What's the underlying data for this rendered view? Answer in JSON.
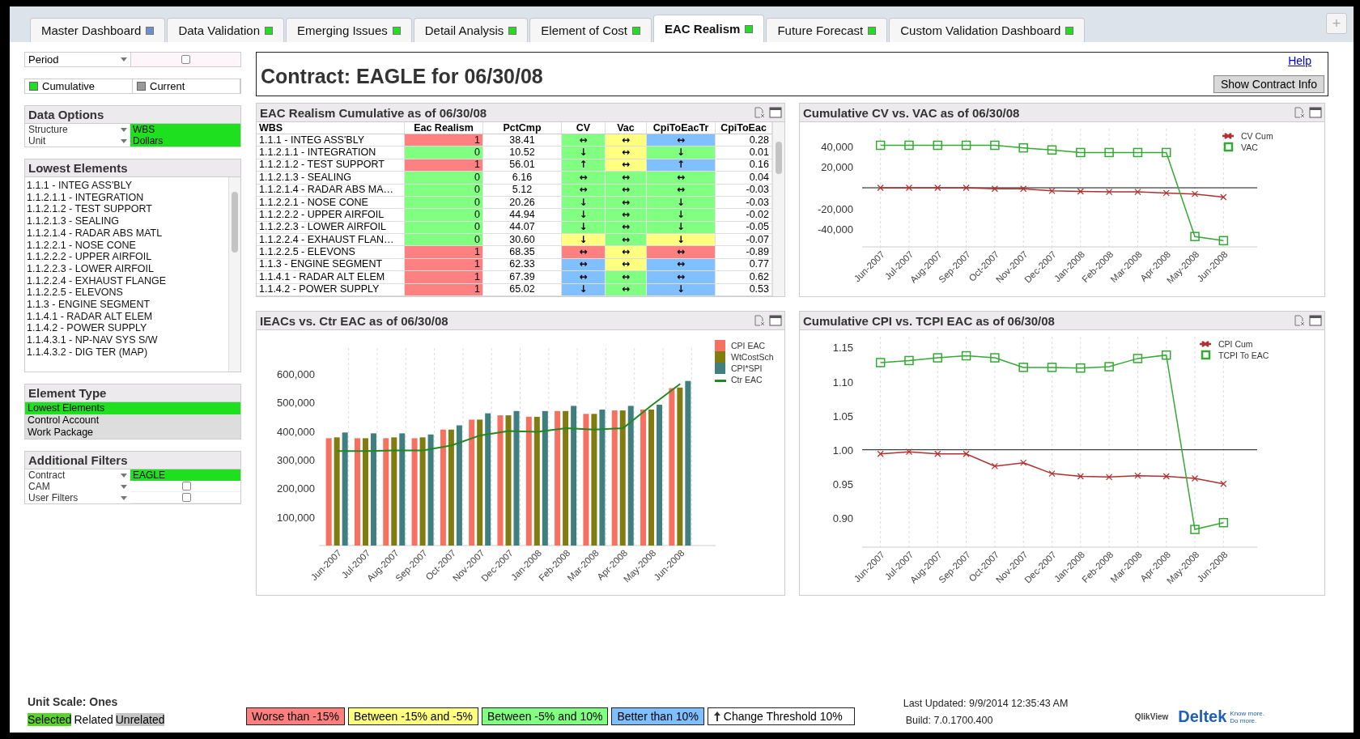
{
  "tabs": [
    {
      "label": "Master Dashboard",
      "color": "#6f8fcf",
      "selected": false
    },
    {
      "label": "Data Validation",
      "color": "#22dd22",
      "selected": false
    },
    {
      "label": "Emerging Issues",
      "color": "#22dd22",
      "selected": false
    },
    {
      "label": "Detail Analysis",
      "color": "#22dd22",
      "selected": false
    },
    {
      "label": "Element of Cost",
      "color": "#22dd22",
      "selected": false
    },
    {
      "label": "EAC Realism",
      "color": "#22dd22",
      "selected": true
    },
    {
      "label": "Future Forecast",
      "color": "#22dd22",
      "selected": false
    },
    {
      "label": "Custom Validation Dashboard",
      "color": "#22dd22",
      "selected": false
    }
  ],
  "add_tab": "+",
  "period": {
    "label": "Period",
    "checked": false
  },
  "view_mode": [
    {
      "label": "Cumulative",
      "selected": true
    },
    {
      "label": "Current",
      "selected": false
    }
  ],
  "data_options": {
    "title": "Data Options",
    "fields": [
      {
        "label": "Structure",
        "value": "WBS"
      },
      {
        "label": "Unit",
        "value": "Dollars"
      }
    ]
  },
  "lowest_elements": {
    "title": "Lowest Elements",
    "items": [
      "1.1.1 - INTEG ASS'BLY",
      "1.1.2.1.1 - INTEGRATION",
      "1.1.2.1.2 - TEST SUPPORT",
      "1.1.2.1.3 - SEALING",
      "1.1.2.1.4 - RADAR ABS MATL",
      "1.1.2.2.1 - NOSE CONE",
      "1.1.2.2.2 - UPPER AIRFOIL",
      "1.1.2.2.3 - LOWER AIRFOIL",
      "1.1.2.2.4 - EXHAUST FLANGE",
      "1.1.2.2.5 - ELEVONS",
      "1.1.3 - ENGINE SEGMENT",
      "1.1.4.1 - RADAR ALT ELEM",
      "1.1.4.2 - POWER SUPPLY",
      "1.1.4.3.1 - NP-NAV SYS S/W",
      "1.1.4.3.2 - DIG TER (MAP)"
    ]
  },
  "element_type": {
    "title": "Element Type",
    "items": [
      {
        "label": "Lowest Elements",
        "selected": true
      },
      {
        "label": "Control Account",
        "selected": false
      },
      {
        "label": "Work Package",
        "selected": false
      }
    ]
  },
  "additional_filters": {
    "title": "Additional Filters",
    "fields": [
      {
        "label": "Contract",
        "kind": "value",
        "value": "EAGLE"
      },
      {
        "label": "CAM",
        "kind": "checkbox",
        "checked": false
      },
      {
        "label": "User Filters",
        "kind": "checkbox",
        "checked": false
      }
    ]
  },
  "header": {
    "title": "Contract: EAGLE for 06/30/08",
    "help_link": "Help",
    "button": "Show Contract Info"
  },
  "table": {
    "title": "EAC Realism Cumulative as of 06/30/08",
    "columns": [
      "WBS",
      "Eac Realism",
      "PctCmp",
      "CV",
      "Vac",
      "CpiToEacTr",
      "CpiToEac"
    ],
    "rows": [
      {
        "wbs": "1.1.1 - INTEG ASS'BLY",
        "eac_realism": {
          "text": "1",
          "color": "#ff8080"
        },
        "pct_cmp": "38.41",
        "cv": {
          "text": "↔",
          "color": "#80ff80"
        },
        "vac": {
          "text": "↔",
          "color": "#ffff80"
        },
        "cpi_tr": {
          "text": "↔",
          "color": "#80c0ff"
        },
        "cpi_to_eac": "0.28"
      },
      {
        "wbs": "1.1.2.1.1 - INTEGRATION",
        "eac_realism": {
          "text": "0",
          "color": "#80ff80"
        },
        "pct_cmp": "10.52",
        "cv": {
          "text": "↓",
          "color": "#80ff80"
        },
        "vac": {
          "text": "↔",
          "color": "#ffff80"
        },
        "cpi_tr": {
          "text": "↓",
          "color": "#80ff80"
        },
        "cpi_to_eac": "0.01"
      },
      {
        "wbs": "1.1.2.1.2 - TEST SUPPORT",
        "eac_realism": {
          "text": "1",
          "color": "#ff8080"
        },
        "pct_cmp": "56.01",
        "cv": {
          "text": "↑",
          "color": "#80ff80"
        },
        "vac": {
          "text": "↔",
          "color": "#ffff80"
        },
        "cpi_tr": {
          "text": "↑",
          "color": "#80c0ff"
        },
        "cpi_to_eac": "0.16"
      },
      {
        "wbs": "1.1.2.1.3 - SEALING",
        "eac_realism": {
          "text": "0",
          "color": "#80ff80"
        },
        "pct_cmp": "6.16",
        "cv": {
          "text": "↔",
          "color": "#80ff80"
        },
        "vac": {
          "text": "↔",
          "color": "#80ff80"
        },
        "cpi_tr": {
          "text": "↔",
          "color": "#80ff80"
        },
        "cpi_to_eac": "0.04"
      },
      {
        "wbs": "1.1.2.1.4 - RADAR ABS MA…",
        "eac_realism": {
          "text": "0",
          "color": "#80ff80"
        },
        "pct_cmp": "5.12",
        "cv": {
          "text": "↔",
          "color": "#80ff80"
        },
        "vac": {
          "text": "↔",
          "color": "#80ff80"
        },
        "cpi_tr": {
          "text": "↔",
          "color": "#80ff80"
        },
        "cpi_to_eac": "-0.03"
      },
      {
        "wbs": "1.1.2.2.1 - NOSE CONE",
        "eac_realism": {
          "text": "0",
          "color": "#80ff80"
        },
        "pct_cmp": "20.26",
        "cv": {
          "text": "↓",
          "color": "#80ff80"
        },
        "vac": {
          "text": "↔",
          "color": "#80ff80"
        },
        "cpi_tr": {
          "text": "↓",
          "color": "#80ff80"
        },
        "cpi_to_eac": "-0.03"
      },
      {
        "wbs": "1.1.2.2.2 - UPPER AIRFOIL",
        "eac_realism": {
          "text": "0",
          "color": "#80ff80"
        },
        "pct_cmp": "44.94",
        "cv": {
          "text": "↓",
          "color": "#80ff80"
        },
        "vac": {
          "text": "↔",
          "color": "#80ff80"
        },
        "cpi_tr": {
          "text": "↓",
          "color": "#80ff80"
        },
        "cpi_to_eac": "-0.02"
      },
      {
        "wbs": "1.1.2.2.3 - LOWER AIRFOIL",
        "eac_realism": {
          "text": "0",
          "color": "#80ff80"
        },
        "pct_cmp": "44.07",
        "cv": {
          "text": "↓",
          "color": "#80ff80"
        },
        "vac": {
          "text": "↔",
          "color": "#80ff80"
        },
        "cpi_tr": {
          "text": "↓",
          "color": "#80ff80"
        },
        "cpi_to_eac": "-0.05"
      },
      {
        "wbs": "1.1.2.2.4 - EXHAUST FLAN…",
        "eac_realism": {
          "text": "0",
          "color": "#80ff80"
        },
        "pct_cmp": "30.60",
        "cv": {
          "text": "↓",
          "color": "#ffff80"
        },
        "vac": {
          "text": "↔",
          "color": "#80ff80"
        },
        "cpi_tr": {
          "text": "↓",
          "color": "#ffff80"
        },
        "cpi_to_eac": "-0.07"
      },
      {
        "wbs": "1.1.2.2.5 - ELEVONS",
        "eac_realism": {
          "text": "1",
          "color": "#ff8080"
        },
        "pct_cmp": "68.35",
        "cv": {
          "text": "↔",
          "color": "#ff8080"
        },
        "vac": {
          "text": "↔",
          "color": "#ffff80"
        },
        "cpi_tr": {
          "text": "↔",
          "color": "#ff8080"
        },
        "cpi_to_eac": "-0.89"
      },
      {
        "wbs": "1.1.3 - ENGINE SEGMENT",
        "eac_realism": {
          "text": "1",
          "color": "#ff8080"
        },
        "pct_cmp": "62.33",
        "cv": {
          "text": "↔",
          "color": "#80c0ff"
        },
        "vac": {
          "text": "↔",
          "color": "#ffff80"
        },
        "cpi_tr": {
          "text": "↔",
          "color": "#80c0ff"
        },
        "cpi_to_eac": "0.77"
      },
      {
        "wbs": "1.1.4.1 - RADAR ALT ELEM",
        "eac_realism": {
          "text": "1",
          "color": "#ff8080"
        },
        "pct_cmp": "67.39",
        "cv": {
          "text": "↔",
          "color": "#80c0ff"
        },
        "vac": {
          "text": "↔",
          "color": "#80ff80"
        },
        "cpi_tr": {
          "text": "↔",
          "color": "#80c0ff"
        },
        "cpi_to_eac": "0.62"
      },
      {
        "wbs": "1.1.4.2 - POWER SUPPLY",
        "eac_realism": {
          "text": "1",
          "color": "#ff8080"
        },
        "pct_cmp": "65.02",
        "cv": {
          "text": "↓",
          "color": "#80c0ff"
        },
        "vac": {
          "text": "↔",
          "color": "#80ff80"
        },
        "cpi_tr": {
          "text": "↓",
          "color": "#80c0ff"
        },
        "cpi_to_eac": "0.53"
      }
    ]
  },
  "cv_chart": {
    "title": "Cumulative CV vs. VAC as of 06/30/08",
    "chart_data": {
      "type": "line",
      "categories": [
        "Jun-2007",
        "Jul-2007",
        "Aug-2007",
        "Sep-2007",
        "Oct-2007",
        "Nov-2007",
        "Dec-2007",
        "Jan-2008",
        "Feb-2008",
        "Mar-2008",
        "Apr-2008",
        "May-2008",
        "Jun-2008"
      ],
      "series": [
        {
          "name": "CV Cum",
          "color": "#b03030",
          "marker": "x",
          "values": [
            0,
            0,
            0,
            0,
            -1000,
            -1000,
            -3000,
            -3500,
            -4000,
            -4000,
            -5000,
            -6000,
            -9000
          ]
        },
        {
          "name": "VAC",
          "color": "#33aa33",
          "marker": "square",
          "values": [
            41000,
            41000,
            41000,
            41000,
            41000,
            38500,
            36500,
            34000,
            34000,
            34000,
            34000,
            -47000,
            -51000
          ]
        }
      ],
      "ylim": [
        -57000,
        57000
      ],
      "yticks": [
        {
          "value": 40000,
          "label": "40,000"
        },
        {
          "value": 20000,
          "label": "20,000"
        },
        {
          "value": -20000,
          "label": "-20,000"
        },
        {
          "value": -40000,
          "label": "-40,000"
        }
      ],
      "legend": true,
      "grid": true
    }
  },
  "ieac_chart": {
    "title": "IEACs vs. Ctr EAC as of 06/30/08",
    "chart_data": {
      "type": "bar",
      "categories": [
        "Jun-2007",
        "Jul-2007",
        "Aug-2007",
        "Sep-2007",
        "Oct-2007",
        "Nov-2007",
        "Dec-2007",
        "Jan-2008",
        "Feb-2008",
        "Mar-2008",
        "Apr-2008",
        "May-2008",
        "Jun-2008"
      ],
      "series": [
        {
          "name": "CPI EAC",
          "color": "#f87060",
          "values": [
            375000,
            375000,
            375000,
            375000,
            405000,
            440000,
            455000,
            450000,
            470000,
            460000,
            472000,
            475000,
            550000
          ]
        },
        {
          "name": "WtCostSch",
          "color": "#807c10",
          "values": [
            378000,
            375000,
            378000,
            378000,
            405000,
            440000,
            455000,
            450000,
            470000,
            460000,
            472000,
            475000,
            552000
          ]
        },
        {
          "name": "CPI*SPI",
          "color": "#3f7f80",
          "values": [
            395000,
            392000,
            392000,
            388000,
            420000,
            462000,
            470000,
            470000,
            488000,
            475000,
            488000,
            492000,
            575000
          ]
        },
        {
          "name": "Ctr EAC",
          "color": "#228822",
          "type": "line",
          "values": [
            330000,
            330000,
            332000,
            332000,
            350000,
            385000,
            400000,
            397000,
            410000,
            405000,
            410000,
            490000,
            565000
          ]
        }
      ],
      "ylim": [
        0,
        690000
      ],
      "yticks": [
        {
          "value": 100000,
          "label": "100,000"
        },
        {
          "value": 200000,
          "label": "200,000"
        },
        {
          "value": 300000,
          "label": "300,000"
        },
        {
          "value": 400000,
          "label": "400,000"
        },
        {
          "value": 500000,
          "label": "500,000"
        },
        {
          "value": 600000,
          "label": "600,000"
        }
      ],
      "legend": true,
      "grid": true
    }
  },
  "cpi_chart": {
    "title": "Cumulative CPI vs. TCPI EAC as of 06/30/08",
    "chart_data": {
      "type": "line",
      "categories": [
        "Jun-2007",
        "Jul-2007",
        "Aug-2007",
        "Sep-2007",
        "Oct-2007",
        "Nov-2007",
        "Dec-2007",
        "Jan-2008",
        "Feb-2008",
        "Mar-2008",
        "Apr-2008",
        "May-2008",
        "Jun-2008"
      ],
      "series": [
        {
          "name": "CPI Cum",
          "color": "#b03030",
          "marker": "x",
          "values": [
            0.994,
            0.997,
            0.994,
            0.994,
            0.976,
            0.981,
            0.965,
            0.961,
            0.96,
            0.962,
            0.961,
            0.958,
            0.95
          ]
        },
        {
          "name": "TCPI To EAC",
          "color": "#33aa33",
          "marker": "square",
          "values": [
            1.128,
            1.131,
            1.135,
            1.138,
            1.135,
            1.121,
            1.121,
            1.12,
            1.122,
            1.134,
            1.139,
            0.883,
            0.893
          ]
        }
      ],
      "ylim": [
        0.857,
        1.166
      ],
      "yticks": [
        {
          "value": 0.9,
          "label": "0.90"
        },
        {
          "value": 0.95,
          "label": "0.95"
        },
        {
          "value": 1.0,
          "label": "1.00"
        },
        {
          "value": 1.05,
          "label": "1.05"
        },
        {
          "value": 1.1,
          "label": "1.10"
        },
        {
          "value": 1.15,
          "label": "1.15"
        }
      ],
      "ref_lines": [
        {
          "axis": "y",
          "value": 1.0,
          "color": "#111111"
        }
      ],
      "legend": true,
      "grid": true
    }
  },
  "footer": {
    "unit_scale": "Unit Scale: Ones",
    "selection_legend": [
      {
        "label": "Selected",
        "kind": "selected"
      },
      {
        "label": "Related",
        "kind": "related"
      },
      {
        "label": "Unrelated",
        "kind": "unrelated"
      }
    ],
    "threshold_legend": [
      {
        "label": "Worse than -15%",
        "color": "#ff7f7f"
      },
      {
        "label": "Between -15% and -5%",
        "color": "#ffff80"
      },
      {
        "label": "Between -5% and 10%",
        "color": "#80ff80"
      },
      {
        "label": "Better than 10%",
        "color": "#80bfff"
      }
    ],
    "change_threshold": "Change Threshold 10%",
    "last_updated": "Last Updated: 9/9/2014 12:35:43 AM",
    "build": "Build: 7.0.1700.400",
    "qlikview_logo": "QlikView",
    "deltek_logo": "Deltek",
    "deltek_tagline": [
      "Know more.",
      "Do more."
    ]
  }
}
